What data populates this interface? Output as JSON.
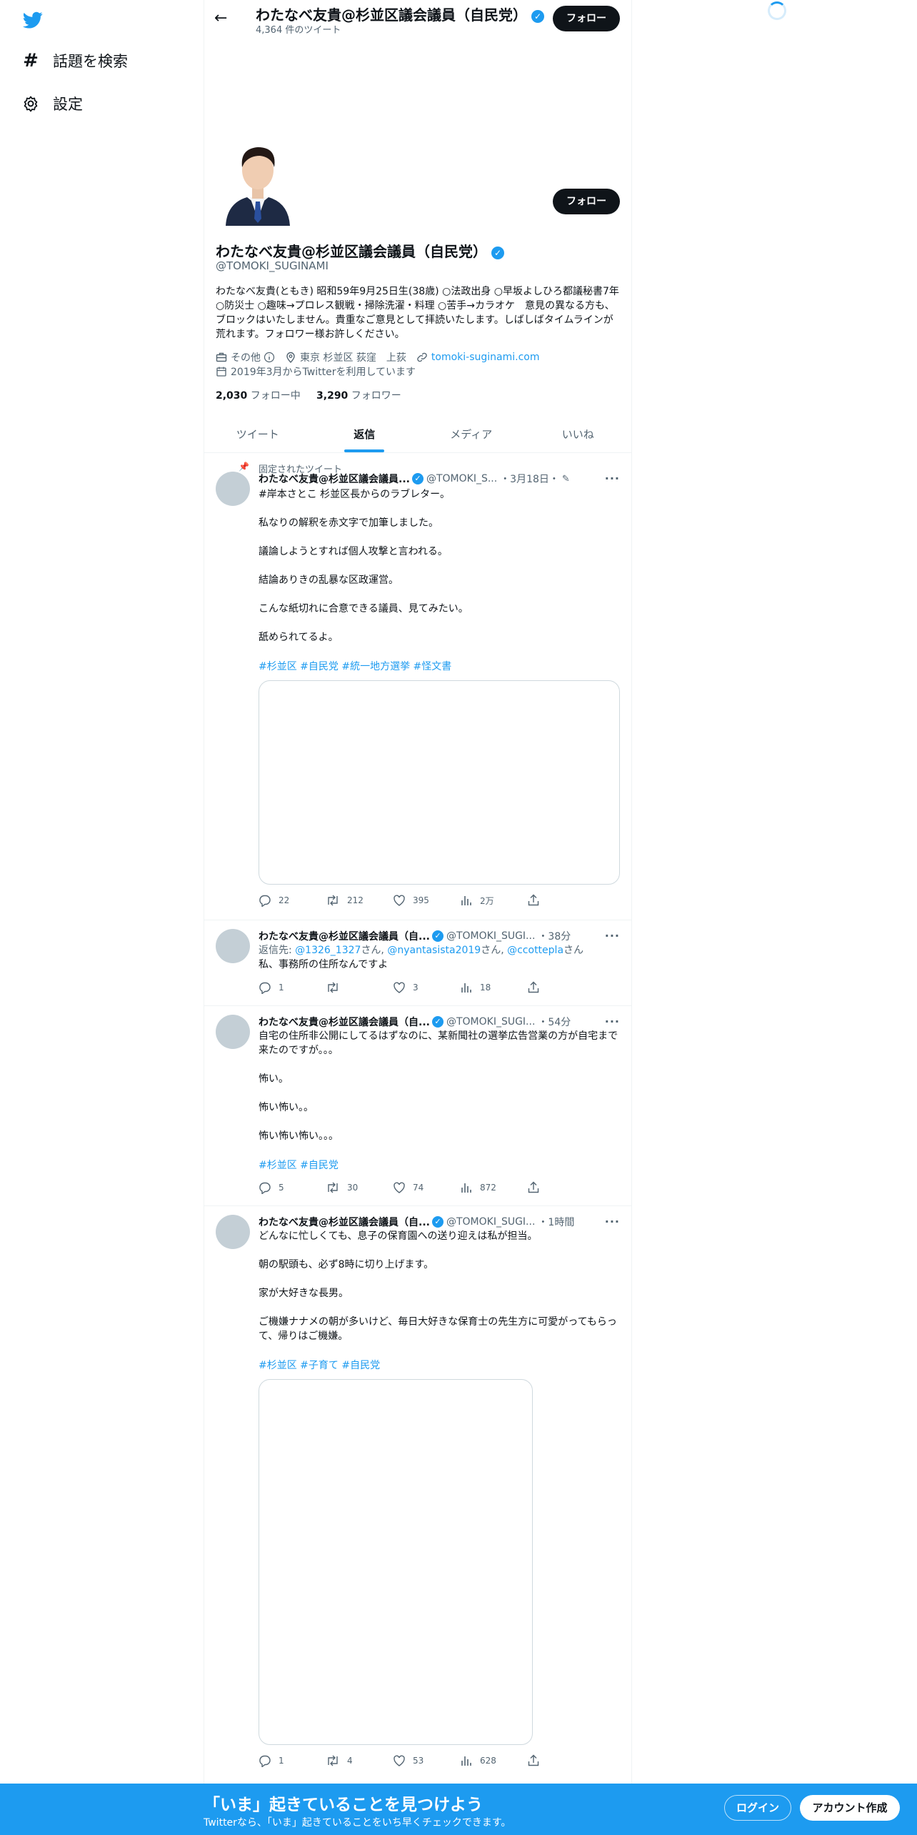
{
  "nav": {
    "explore_label": "話題を検索",
    "settings_label": "設定"
  },
  "topbar": {
    "name": "わたなべ友貴@杉並区議会議員（自民党）",
    "tweet_count": "4,364 件のツイート",
    "follow_label": "フォロー"
  },
  "profile": {
    "name": "わたなべ友貴@杉並区議会議員（自民党）",
    "handle": "@TOMOKI_SUGINAMI",
    "bio": "わたなべ友貴(ともき) 昭和59年9月25日生(38歳) ○法政出身 ○早坂よしひろ都議秘書7年 ○防災士 ○趣味→プロレス観戦・掃除洗濯・料理 ○苦手→カラオケ　意見の異なる方も、ブロックはいたしません。貴重なご意見として拝読いたします。しばしばタイムラインが荒れます。フォロワー様お許しください。",
    "category": "その他",
    "location": "東京 杉並区 荻窪　上荻",
    "url": "tomoki-suginami.com",
    "joined": "2019年3月からTwitterを利用しています",
    "following_count": "2,030",
    "following_label": "フォロー中",
    "followers_count": "3,290",
    "followers_label": "フォロワー",
    "follow_label": "フォロー"
  },
  "tabs": [
    "ツイート",
    "返信",
    "メディア",
    "いいね"
  ],
  "tweets": [
    {
      "pinned_label": "固定されたツイート",
      "name": "わたなべ友貴@杉並区議会議員...",
      "handle": "@TOMOKI_S...",
      "time": "・3月18日・",
      "text": "#岸本さとこ 杉並区長からのラブレター。\n\n私なりの解釈を赤文字で加筆しました。\n\n議論しようとすれば個人攻撃と言われる。\n\n結論ありきの乱暴な区政運営。\n\nこんな紙切れに合意できる議員、見てみたい。\n\n舐められてるよ。",
      "tags": "#杉並区 #自民党 #統一地方選挙 #怪文書",
      "replies": "22",
      "retweets": "212",
      "likes": "395",
      "views": "2万"
    },
    {
      "name": "わたなべ友貴@杉並区議会議員（自...",
      "handle": "@TOMOKI_SUGI...",
      "time": "・38分",
      "reply_prefix": "返信先: ",
      "reply_to_1": "@1326_1327",
      "reply_sep_1": "さん, ",
      "reply_to_2": "@nyantasista2019",
      "reply_sep_2": "さん, ",
      "reply_to_3": "@ccottepla",
      "reply_suffix": "さん",
      "text": "私、事務所の住所なんですよ",
      "replies": "1",
      "retweets": "",
      "likes": "3",
      "views": "18"
    },
    {
      "name": "わたなべ友貴@杉並区議会議員（自...",
      "handle": "@TOMOKI_SUGI...",
      "time": "・54分",
      "text": "自宅の住所非公開にしてるはずなのに、某新聞社の選挙広告営業の方が自宅まで来たのですが。。。\n\n怖い。\n\n怖い怖い。。\n\n怖い怖い怖い。。。",
      "tags": "#杉並区 #自民党",
      "replies": "5",
      "retweets": "30",
      "likes": "74",
      "views": "872"
    },
    {
      "name": "わたなべ友貴@杉並区議会議員（自...",
      "handle": "@TOMOKI_SUGI...",
      "time": "・1時間",
      "text": "どんなに忙しくても、息子の保育園への送り迎えは私が担当。\n\n朝の駅頭も、必ず8時に切り上げます。\n\n家が大好きな長男。\n\nご機嫌ナナメの朝が多いけど、毎日大好きな保育士の先生方に可愛がってもらって、帰りはご機嫌。",
      "tags": "#杉並区 #子育て #自民党",
      "replies": "1",
      "retweets": "4",
      "likes": "53",
      "views": "628"
    }
  ],
  "bottom_bar": {
    "title": "「いま」起きていることを見つけよう",
    "subtitle": "Twitterなら、「いま」起きていることをいち早くチェックできます。",
    "login_label": "ログイン",
    "signup_label": "アカウント作成"
  },
  "colors": {
    "accent": "#1d9bf0",
    "text": "#0f1419",
    "muted": "#536471"
  }
}
